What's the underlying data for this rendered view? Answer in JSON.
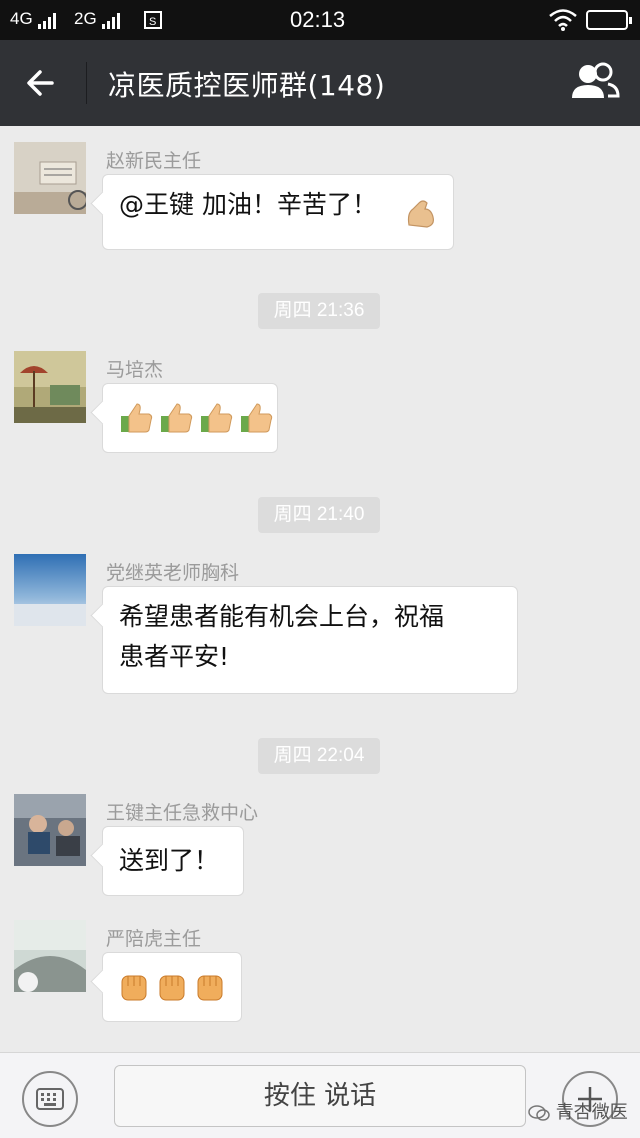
{
  "status_bar": {
    "network1": "4G",
    "network2": "2G",
    "time": "02:13"
  },
  "header": {
    "title": "凉医质控医师群(148)"
  },
  "messages": [
    {
      "sender": "赵新民主任",
      "text": "@王键 加油！辛苦了！",
      "emoji": "flexed-biceps"
    },
    {
      "timestamp": "周四 21:36"
    },
    {
      "sender": "马培杰",
      "emoji": [
        "thumbs-up",
        "thumbs-up",
        "thumbs-up",
        "thumbs-up"
      ]
    },
    {
      "timestamp": "周四 21:40"
    },
    {
      "sender": "党继英老师胸科",
      "text_line1": "希望患者能有机会上台，祝福",
      "text_line2": "患者平安!"
    },
    {
      "timestamp": "周四 22:04"
    },
    {
      "sender": "王键主任急救中心",
      "text": "送到了！"
    },
    {
      "sender": "严陪虎主任",
      "emoji": [
        "fist",
        "fist",
        "fist"
      ]
    }
  ],
  "input": {
    "hold_to_talk": "按住 说话"
  },
  "watermark": "青杏微医",
  "colors": {
    "title_bar": "#303236",
    "background": "#ebebeb",
    "bubble": "#ffffff"
  }
}
